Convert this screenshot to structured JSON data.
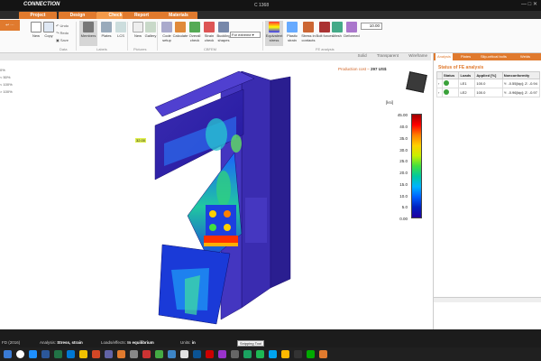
{
  "app": {
    "name": "CONNECTION",
    "document": "C 1368",
    "window_controls": "— □ ✕"
  },
  "main_tabs": [
    {
      "label": "Project",
      "active": false
    },
    {
      "label": "Design",
      "active": false
    },
    {
      "label": "Check",
      "active": true
    },
    {
      "label": "Report",
      "active": false
    },
    {
      "label": "Materials",
      "active": false
    }
  ],
  "ribbon": {
    "active_label": "↩ ···",
    "buttons": [
      {
        "label": "New",
        "icon": "new-file-icon"
      },
      {
        "label": "Copy",
        "icon": "copy-icon"
      },
      {
        "label": "Undo",
        "icon": "undo-icon"
      },
      {
        "label": "Redo",
        "icon": "redo-icon"
      },
      {
        "label": "Save",
        "icon": "save-icon"
      },
      {
        "label": "Members",
        "icon": "members-icon"
      },
      {
        "label": "Plates",
        "icon": "plates-icon"
      },
      {
        "label": "LCS",
        "icon": "lcs-icon"
      },
      {
        "label": "New",
        "icon": "new-picture-icon"
      },
      {
        "label": "Gallery",
        "icon": "gallery-icon"
      },
      {
        "label": "Code setup",
        "icon": "code-setup-icon"
      },
      {
        "label": "Calculate",
        "icon": "calculate-icon"
      },
      {
        "label": "Overall check",
        "icon": "overall-check-icon"
      },
      {
        "label": "Strain check",
        "icon": "strain-check-icon"
      },
      {
        "label": "Buckling shapes",
        "icon": "buckling-icon"
      },
      {
        "label": "Equivalent stress",
        "icon": "equivalent-stress-icon"
      },
      {
        "label": "Plastic strain",
        "icon": "plastic-strain-icon"
      },
      {
        "label": "Stress in contacts",
        "icon": "contact-stress-icon"
      },
      {
        "label": "Bolt forces",
        "icon": "bolt-forces-icon"
      },
      {
        "label": "Mesh",
        "icon": "mesh-icon"
      },
      {
        "label": "Deformed",
        "icon": "deformed-icon"
      }
    ],
    "groups": [
      "Data",
      "Labels",
      "Pictures",
      "CBFEM",
      "FE analysis"
    ],
    "extreme_select": "For extreme",
    "scale_value": "10.00"
  },
  "view_modes": [
    "Solid",
    "Transparent",
    "Wireframe"
  ],
  "production_cost": {
    "label": "Production cost –",
    "value": "297 US$"
  },
  "legend_left": [
    "0%",
    "< 50%",
    "< 100%",
    "> 100%"
  ],
  "scale": {
    "unit": "[ksi]",
    "ticks": [
      "45.00",
      "40.0",
      "35.0",
      "30.0",
      "25.0",
      "20.0",
      "15.0",
      "10.0",
      "5.0",
      "0.00"
    ]
  },
  "model_label": "32.00",
  "right_panel": {
    "tabs": [
      "Analysis",
      "Plates",
      "Slip-critical bolts",
      "Welds"
    ],
    "title": "Status of FE analysis",
    "columns": [
      "Status",
      "Loads",
      "Applied [%]",
      "Nonconformity"
    ],
    "rows": [
      {
        "status": "ok",
        "load": "LE1",
        "applied": "100.0",
        "nonconformity": "Y: -0.55[kip]; Z: -0.94"
      },
      {
        "status": "ok",
        "load": "LE2",
        "applied": "100.0",
        "nonconformity": "Y: -0.96[kip]; Z: -0.97"
      }
    ]
  },
  "status_bar": {
    "code": "FD (2016)",
    "analysis_label": "Analysis:",
    "analysis_value": "Stress, strain",
    "loads_label": "Loads/effects:",
    "loads_value": "In equilibrium",
    "units_label": "Units:",
    "units_value": "in"
  },
  "tooltip": "Snipping Tool"
}
